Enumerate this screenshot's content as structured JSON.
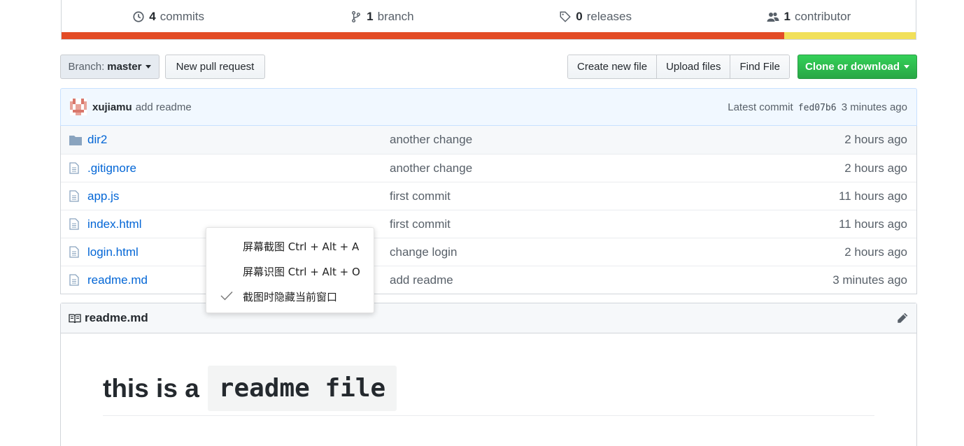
{
  "summary": {
    "commits_count": "4",
    "commits_label": "commits",
    "branch_count": "1",
    "branch_label": "branch",
    "releases_count": "0",
    "releases_label": "releases",
    "contributor_count": "1",
    "contributor_label": "contributor",
    "language_fractions": [
      0.846,
      0.154
    ],
    "language_colors": [
      "#e34c26",
      "#f1e05a"
    ]
  },
  "toolbar": {
    "branch_prefix": "Branch:",
    "branch_name": "master",
    "new_pr": "New pull request",
    "create_file": "Create new file",
    "upload_files": "Upload files",
    "find_file": "Find File",
    "clone": "Clone or download",
    "clone_color": "#28a745"
  },
  "commit": {
    "author": "xujiamu",
    "message": "add readme",
    "latest_label": "Latest commit",
    "sha": "fed07b6",
    "age": "3 minutes ago"
  },
  "files": [
    {
      "icon": "folder-icon",
      "name": "dir2",
      "message": "another change",
      "age": "2 hours ago"
    },
    {
      "icon": "file-icon",
      "name": ".gitignore",
      "message": "another change",
      "age": "2 hours ago"
    },
    {
      "icon": "file-icon",
      "name": "app.js",
      "message": "first commit",
      "age": "11 hours ago"
    },
    {
      "icon": "file-icon",
      "name": "index.html",
      "message": "first commit",
      "age": "11 hours ago"
    },
    {
      "icon": "file-icon",
      "name": "login.html",
      "message": "change login",
      "age": "2 hours ago"
    },
    {
      "icon": "file-icon",
      "name": "readme.md",
      "message": "add readme",
      "age": "3 minutes ago"
    }
  ],
  "readme": {
    "filename": "readme.md",
    "heading_text": "this is a",
    "heading_code": "readme file"
  },
  "context_menu": {
    "items": [
      {
        "label": "屏幕截图 Ctrl + Alt + A",
        "checked": false
      },
      {
        "label": "屏幕识图 Ctrl + Alt + O",
        "checked": false
      },
      {
        "label": "截图时隐藏当前窗口",
        "checked": true
      }
    ]
  }
}
